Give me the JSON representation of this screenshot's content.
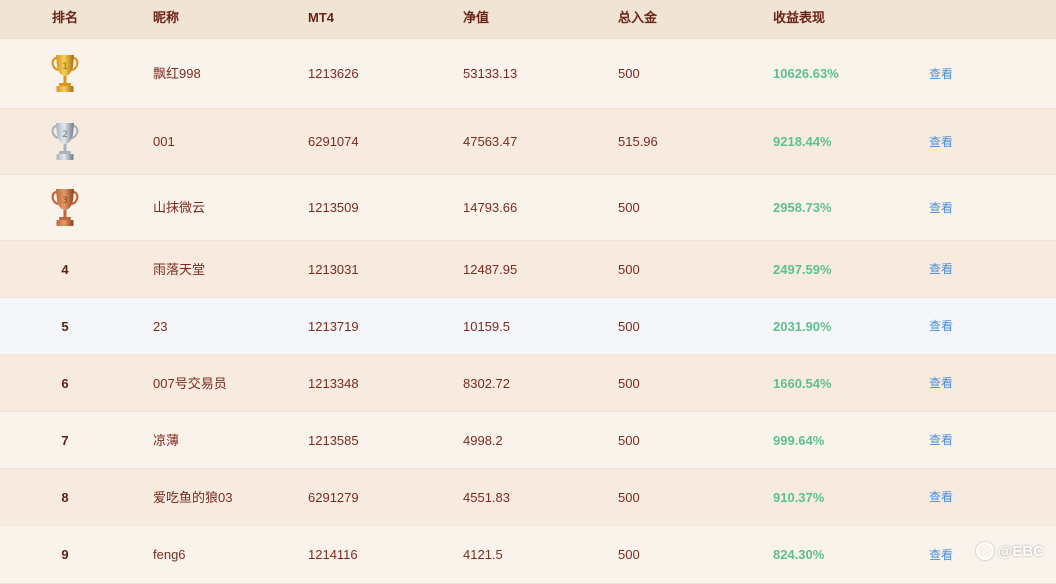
{
  "header": {
    "rank": "排名",
    "nickname": "昵称",
    "mt4": "MT4",
    "equity": "净值",
    "deposit": "总入金",
    "return": "收益表现"
  },
  "colors": {
    "return_green": "#5ec08f",
    "link_blue": "#4b8fd8",
    "text_brown": "#7a2b1e",
    "gold": "#e0a72a",
    "silver": "#a9b3bf",
    "bronze": "#c0663a"
  },
  "rows": [
    {
      "rank": "1",
      "trophy": "gold-trophy-icon",
      "nickname": "飘红998",
      "mt4": "1213626",
      "equity": "53133.13",
      "deposit": "500",
      "return": "10626.63%",
      "action": "查看"
    },
    {
      "rank": "2",
      "trophy": "silver-trophy-icon",
      "nickname": "001",
      "mt4": "6291074",
      "equity": "47563.47",
      "deposit": "515.96",
      "return": "9218.44%",
      "action": "查看"
    },
    {
      "rank": "3",
      "trophy": "bronze-trophy-icon",
      "nickname": "山抹微云",
      "mt4": "1213509",
      "equity": "14793.66",
      "deposit": "500",
      "return": "2958.73%",
      "action": "查看"
    },
    {
      "rank": "4",
      "nickname": "雨落天堂",
      "mt4": "1213031",
      "equity": "12487.95",
      "deposit": "500",
      "return": "2497.59%",
      "action": "查看"
    },
    {
      "rank": "5",
      "nickname": "23",
      "mt4": "1213719",
      "equity": "10159.5",
      "deposit": "500",
      "return": "2031.90%",
      "action": "查看"
    },
    {
      "rank": "6",
      "nickname": "007号交易员",
      "mt4": "1213348",
      "equity": "8302.72",
      "deposit": "500",
      "return": "1660.54%",
      "action": "查看"
    },
    {
      "rank": "7",
      "nickname": "凉薄",
      "mt4": "1213585",
      "equity": "4998.2",
      "deposit": "500",
      "return": "999.64%",
      "action": "查看"
    },
    {
      "rank": "8",
      "nickname": "爱吃鱼的狼03",
      "mt4": "6291279",
      "equity": "4551.83",
      "deposit": "500",
      "return": "910.37%",
      "action": "查看"
    },
    {
      "rank": "9",
      "nickname": "feng6",
      "mt4": "1214116",
      "equity": "4121.5",
      "deposit": "500",
      "return": "824.30%",
      "action": "查看"
    }
  ],
  "watermark": "@EBC"
}
